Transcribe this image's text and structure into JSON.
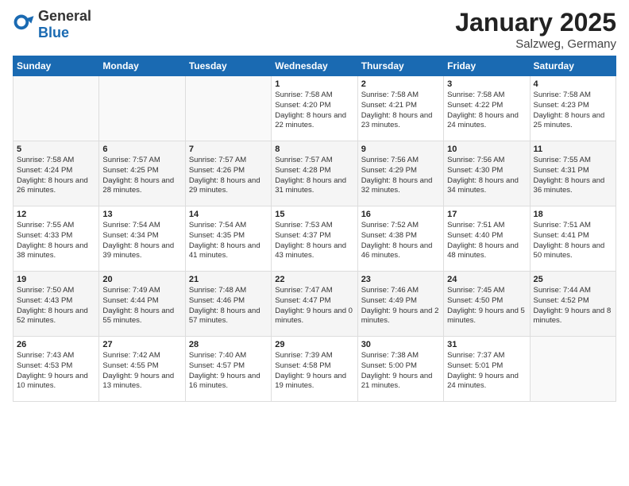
{
  "header": {
    "logo_general": "General",
    "logo_blue": "Blue",
    "title": "January 2025",
    "subtitle": "Salzweg, Germany"
  },
  "days_of_week": [
    "Sunday",
    "Monday",
    "Tuesday",
    "Wednesday",
    "Thursday",
    "Friday",
    "Saturday"
  ],
  "weeks": [
    [
      {
        "day": null
      },
      {
        "day": null
      },
      {
        "day": null
      },
      {
        "day": "1",
        "sunrise": "Sunrise: 7:58 AM",
        "sunset": "Sunset: 4:20 PM",
        "daylight": "Daylight: 8 hours and 22 minutes."
      },
      {
        "day": "2",
        "sunrise": "Sunrise: 7:58 AM",
        "sunset": "Sunset: 4:21 PM",
        "daylight": "Daylight: 8 hours and 23 minutes."
      },
      {
        "day": "3",
        "sunrise": "Sunrise: 7:58 AM",
        "sunset": "Sunset: 4:22 PM",
        "daylight": "Daylight: 8 hours and 24 minutes."
      },
      {
        "day": "4",
        "sunrise": "Sunrise: 7:58 AM",
        "sunset": "Sunset: 4:23 PM",
        "daylight": "Daylight: 8 hours and 25 minutes."
      }
    ],
    [
      {
        "day": "5",
        "sunrise": "Sunrise: 7:58 AM",
        "sunset": "Sunset: 4:24 PM",
        "daylight": "Daylight: 8 hours and 26 minutes."
      },
      {
        "day": "6",
        "sunrise": "Sunrise: 7:57 AM",
        "sunset": "Sunset: 4:25 PM",
        "daylight": "Daylight: 8 hours and 28 minutes."
      },
      {
        "day": "7",
        "sunrise": "Sunrise: 7:57 AM",
        "sunset": "Sunset: 4:26 PM",
        "daylight": "Daylight: 8 hours and 29 minutes."
      },
      {
        "day": "8",
        "sunrise": "Sunrise: 7:57 AM",
        "sunset": "Sunset: 4:28 PM",
        "daylight": "Daylight: 8 hours and 31 minutes."
      },
      {
        "day": "9",
        "sunrise": "Sunrise: 7:56 AM",
        "sunset": "Sunset: 4:29 PM",
        "daylight": "Daylight: 8 hours and 32 minutes."
      },
      {
        "day": "10",
        "sunrise": "Sunrise: 7:56 AM",
        "sunset": "Sunset: 4:30 PM",
        "daylight": "Daylight: 8 hours and 34 minutes."
      },
      {
        "day": "11",
        "sunrise": "Sunrise: 7:55 AM",
        "sunset": "Sunset: 4:31 PM",
        "daylight": "Daylight: 8 hours and 36 minutes."
      }
    ],
    [
      {
        "day": "12",
        "sunrise": "Sunrise: 7:55 AM",
        "sunset": "Sunset: 4:33 PM",
        "daylight": "Daylight: 8 hours and 38 minutes."
      },
      {
        "day": "13",
        "sunrise": "Sunrise: 7:54 AM",
        "sunset": "Sunset: 4:34 PM",
        "daylight": "Daylight: 8 hours and 39 minutes."
      },
      {
        "day": "14",
        "sunrise": "Sunrise: 7:54 AM",
        "sunset": "Sunset: 4:35 PM",
        "daylight": "Daylight: 8 hours and 41 minutes."
      },
      {
        "day": "15",
        "sunrise": "Sunrise: 7:53 AM",
        "sunset": "Sunset: 4:37 PM",
        "daylight": "Daylight: 8 hours and 43 minutes."
      },
      {
        "day": "16",
        "sunrise": "Sunrise: 7:52 AM",
        "sunset": "Sunset: 4:38 PM",
        "daylight": "Daylight: 8 hours and 46 minutes."
      },
      {
        "day": "17",
        "sunrise": "Sunrise: 7:51 AM",
        "sunset": "Sunset: 4:40 PM",
        "daylight": "Daylight: 8 hours and 48 minutes."
      },
      {
        "day": "18",
        "sunrise": "Sunrise: 7:51 AM",
        "sunset": "Sunset: 4:41 PM",
        "daylight": "Daylight: 8 hours and 50 minutes."
      }
    ],
    [
      {
        "day": "19",
        "sunrise": "Sunrise: 7:50 AM",
        "sunset": "Sunset: 4:43 PM",
        "daylight": "Daylight: 8 hours and 52 minutes."
      },
      {
        "day": "20",
        "sunrise": "Sunrise: 7:49 AM",
        "sunset": "Sunset: 4:44 PM",
        "daylight": "Daylight: 8 hours and 55 minutes."
      },
      {
        "day": "21",
        "sunrise": "Sunrise: 7:48 AM",
        "sunset": "Sunset: 4:46 PM",
        "daylight": "Daylight: 8 hours and 57 minutes."
      },
      {
        "day": "22",
        "sunrise": "Sunrise: 7:47 AM",
        "sunset": "Sunset: 4:47 PM",
        "daylight": "Daylight: 9 hours and 0 minutes."
      },
      {
        "day": "23",
        "sunrise": "Sunrise: 7:46 AM",
        "sunset": "Sunset: 4:49 PM",
        "daylight": "Daylight: 9 hours and 2 minutes."
      },
      {
        "day": "24",
        "sunrise": "Sunrise: 7:45 AM",
        "sunset": "Sunset: 4:50 PM",
        "daylight": "Daylight: 9 hours and 5 minutes."
      },
      {
        "day": "25",
        "sunrise": "Sunrise: 7:44 AM",
        "sunset": "Sunset: 4:52 PM",
        "daylight": "Daylight: 9 hours and 8 minutes."
      }
    ],
    [
      {
        "day": "26",
        "sunrise": "Sunrise: 7:43 AM",
        "sunset": "Sunset: 4:53 PM",
        "daylight": "Daylight: 9 hours and 10 minutes."
      },
      {
        "day": "27",
        "sunrise": "Sunrise: 7:42 AM",
        "sunset": "Sunset: 4:55 PM",
        "daylight": "Daylight: 9 hours and 13 minutes."
      },
      {
        "day": "28",
        "sunrise": "Sunrise: 7:40 AM",
        "sunset": "Sunset: 4:57 PM",
        "daylight": "Daylight: 9 hours and 16 minutes."
      },
      {
        "day": "29",
        "sunrise": "Sunrise: 7:39 AM",
        "sunset": "Sunset: 4:58 PM",
        "daylight": "Daylight: 9 hours and 19 minutes."
      },
      {
        "day": "30",
        "sunrise": "Sunrise: 7:38 AM",
        "sunset": "Sunset: 5:00 PM",
        "daylight": "Daylight: 9 hours and 21 minutes."
      },
      {
        "day": "31",
        "sunrise": "Sunrise: 7:37 AM",
        "sunset": "Sunset: 5:01 PM",
        "daylight": "Daylight: 9 hours and 24 minutes."
      },
      {
        "day": null
      }
    ]
  ]
}
